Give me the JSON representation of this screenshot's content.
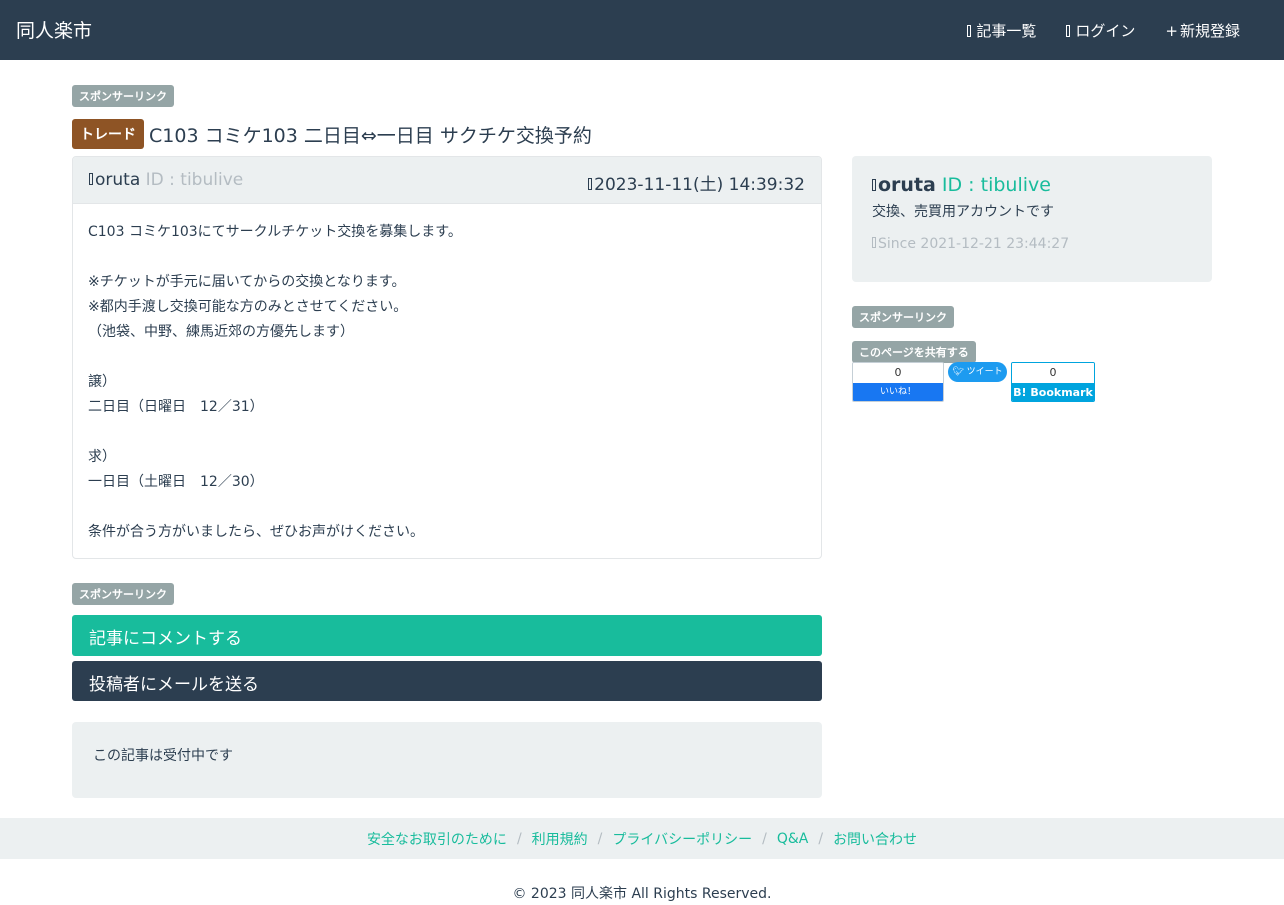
{
  "navbar": {
    "brand": "同人楽市",
    "links": [
      {
        "label": "記事一覧",
        "icon": "list-icon"
      },
      {
        "label": "ログイン",
        "icon": "login-icon"
      },
      {
        "label": "新規登録",
        "icon": "plus-icon"
      }
    ]
  },
  "sponsor_label": "スポンサーリンク",
  "post": {
    "category": "トレード",
    "title": "C103 コミケ103 二日目⇔一日目 サクチケ交換予約",
    "author_name": "oruta",
    "author_id": "ID : tibulive",
    "date": "2023-11-11(土) 14:39:32",
    "body_lines": [
      "C103 コミケ103にてサークルチケット交換を募集します。",
      "",
      "※チケットが手元に届いてからの交換となります。",
      "※都内手渡し交換可能な方のみとさせてください。",
      "（池袋、中野、練馬近郊の方優先します）",
      "",
      "譲）",
      "二日目（日曜日　12／31）",
      "",
      "求）",
      "一日目（土曜日　12／30）",
      "",
      "条件が合う方がいましたら、ぜひお声がけください。"
    ]
  },
  "actions": {
    "comment": "記事にコメントする",
    "mail": "投稿者にメールを送る"
  },
  "status": "この記事は受付中です",
  "profile": {
    "name": "oruta",
    "id": "ID : tibulive",
    "description": "交換、売買用アカウントです",
    "since": "Since 2021-12-21 23:44:27"
  },
  "share": {
    "label": "このページを共有する",
    "fb_count": "0",
    "fb_like": "いいね！",
    "tweet": "ツイート",
    "hb_count": "0",
    "hb_label": "B! Bookmark"
  },
  "footer": {
    "links": [
      "安全なお取引のために",
      "利用規約",
      "プライバシーポリシー",
      "Q&A",
      "お問い合わせ"
    ],
    "copyright": "© 2023 同人楽市 All Rights Reserved."
  },
  "colors": {
    "navbar": "#2c3e50",
    "accent": "#18bc9c",
    "trade_badge": "#8e5425",
    "badge_gray": "#95a5a6",
    "panel": "#ecf0f1"
  }
}
